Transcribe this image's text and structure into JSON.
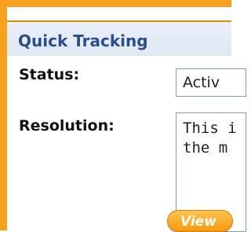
{
  "panel": {
    "title": "Quick Tracking"
  },
  "status": {
    "label": "Status:",
    "value": "Activ"
  },
  "resolution": {
    "label": "Resolution:",
    "text": "This i\nthe m"
  },
  "actions": {
    "view_label": "View"
  },
  "colors": {
    "frame_orange": "#f6a21e",
    "header_background": "#e3eaf7",
    "title_blue": "#2a4e8c",
    "field_border": "#7f9db9",
    "button_orange": "#f59a12"
  }
}
